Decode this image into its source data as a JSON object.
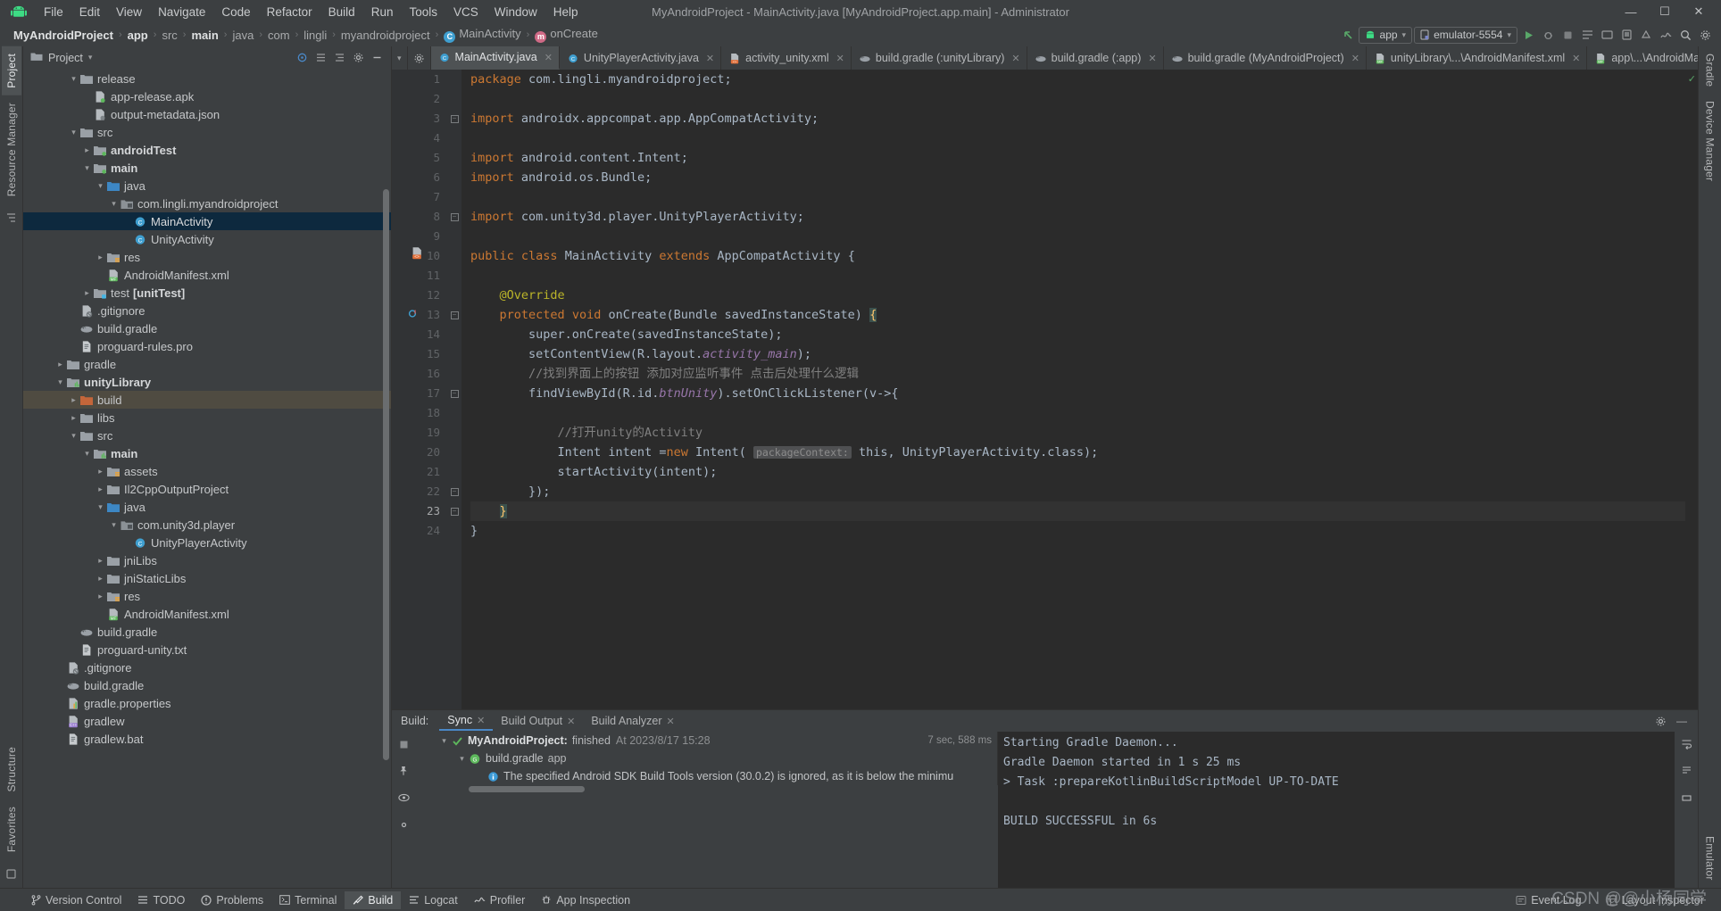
{
  "window": {
    "title": "MyAndroidProject - MainActivity.java [MyAndroidProject.app.main] - Administrator",
    "minimize": "—",
    "maximize": "☐",
    "close": "✕",
    "app_icon": "android-robot-icon"
  },
  "menu": {
    "items": [
      {
        "label": "File"
      },
      {
        "label": "Edit"
      },
      {
        "label": "View"
      },
      {
        "label": "Navigate"
      },
      {
        "label": "Code"
      },
      {
        "label": "Refactor"
      },
      {
        "label": "Build"
      },
      {
        "label": "Run"
      },
      {
        "label": "Tools"
      },
      {
        "label": "VCS"
      },
      {
        "label": "Window"
      },
      {
        "label": "Help"
      }
    ]
  },
  "breadcrumbs": {
    "sep": "›",
    "items": [
      {
        "label": "MyAndroidProject",
        "bold": true,
        "icon": ""
      },
      {
        "label": "app",
        "bold": true,
        "icon": ""
      },
      {
        "label": "src",
        "bold": false,
        "icon": ""
      },
      {
        "label": "main",
        "bold": true,
        "icon": ""
      },
      {
        "label": "java",
        "bold": false,
        "icon": ""
      },
      {
        "label": "com",
        "bold": false,
        "icon": ""
      },
      {
        "label": "lingli",
        "bold": false,
        "icon": ""
      },
      {
        "label": "myandroidproject",
        "bold": false,
        "icon": ""
      },
      {
        "label": "MainActivity",
        "bold": false,
        "icon": "c"
      },
      {
        "label": "onCreate",
        "bold": false,
        "icon": "m"
      }
    ]
  },
  "toolbar": {
    "back_arrow": "back-arrow-icon",
    "module_selector": "app",
    "device_selector": "emulator-5554",
    "dropdown_caret": "▾",
    "run_button": "▶",
    "debug_button": "debug-icon",
    "icons": [
      "run",
      "debug",
      "stop",
      "layout-inspector",
      "device-file-explorer",
      "avd-manager",
      "sdk-manager",
      "profiler",
      "search",
      "settings"
    ]
  },
  "left_strip": {
    "tabs": [
      {
        "label": "Project",
        "active": true
      },
      {
        "label": "Resource Manager",
        "active": false
      }
    ],
    "bottom_tabs": [
      {
        "label": "Structure"
      },
      {
        "label": "Favorites"
      }
    ]
  },
  "right_strip": {
    "tabs": [
      {
        "label": "Gradle"
      },
      {
        "label": "Device Manager"
      },
      {
        "label": "Emulator"
      }
    ]
  },
  "project_panel": {
    "title": "Project",
    "header_icons": [
      "target-icon",
      "collapse-all-icon",
      "expand-icon",
      "settings-icon",
      "hide-icon"
    ],
    "tree": [
      {
        "indent": 3,
        "arrow": "v",
        "icon": "folder",
        "label": "release",
        "bold": false
      },
      {
        "indent": 4,
        "arrow": "",
        "icon": "apk",
        "label": "app-release.apk",
        "bold": false
      },
      {
        "indent": 4,
        "arrow": "",
        "icon": "json",
        "label": "output-metadata.json",
        "bold": false
      },
      {
        "indent": 3,
        "arrow": "v",
        "icon": "folder",
        "label": "src",
        "bold": false
      },
      {
        "indent": 4,
        "arrow": ">",
        "icon": "folder-green",
        "label": "androidTest",
        "bold": true
      },
      {
        "indent": 4,
        "arrow": "v",
        "icon": "folder-green",
        "label": "main",
        "bold": true
      },
      {
        "indent": 5,
        "arrow": "v",
        "icon": "folder-blue",
        "label": "java",
        "bold": false
      },
      {
        "indent": 6,
        "arrow": "v",
        "icon": "package",
        "label": "com.lingli.myandroidproject",
        "bold": false
      },
      {
        "indent": 7,
        "arrow": "",
        "icon": "class",
        "label": "MainActivity",
        "bold": false,
        "state": "sel"
      },
      {
        "indent": 7,
        "arrow": "",
        "icon": "class",
        "label": "UnityActivity",
        "bold": false
      },
      {
        "indent": 5,
        "arrow": ">",
        "icon": "folder-res",
        "label": "res",
        "bold": false
      },
      {
        "indent": 5,
        "arrow": "",
        "icon": "manifest",
        "label": "AndroidManifest.xml",
        "bold": false
      },
      {
        "indent": 4,
        "arrow": ">",
        "icon": "folder-test",
        "label": "test",
        "bold": false,
        "suffix": "[unitTest]"
      },
      {
        "indent": 3,
        "arrow": "",
        "icon": "gitignore",
        "label": ".gitignore",
        "bold": false
      },
      {
        "indent": 3,
        "arrow": "",
        "icon": "gradle",
        "label": "build.gradle",
        "bold": false
      },
      {
        "indent": 3,
        "arrow": "",
        "icon": "textfile",
        "label": "proguard-rules.pro",
        "bold": false
      },
      {
        "indent": 2,
        "arrow": ">",
        "icon": "folder",
        "label": "gradle",
        "bold": false
      },
      {
        "indent": 2,
        "arrow": "v",
        "icon": "module",
        "label": "unityLibrary",
        "bold": true
      },
      {
        "indent": 3,
        "arrow": ">",
        "icon": "folder-build",
        "label": "build",
        "bold": false,
        "state": "build-sel"
      },
      {
        "indent": 3,
        "arrow": ">",
        "icon": "folder",
        "label": "libs",
        "bold": false
      },
      {
        "indent": 3,
        "arrow": "v",
        "icon": "folder",
        "label": "src",
        "bold": false
      },
      {
        "indent": 4,
        "arrow": "v",
        "icon": "module",
        "label": "main",
        "bold": true
      },
      {
        "indent": 5,
        "arrow": ">",
        "icon": "folder-res",
        "label": "assets",
        "bold": false
      },
      {
        "indent": 5,
        "arrow": ">",
        "icon": "folder",
        "label": "Il2CppOutputProject",
        "bold": false
      },
      {
        "indent": 5,
        "arrow": "v",
        "icon": "folder-blue",
        "label": "java",
        "bold": false
      },
      {
        "indent": 6,
        "arrow": "v",
        "icon": "package",
        "label": "com.unity3d.player",
        "bold": false
      },
      {
        "indent": 7,
        "arrow": "",
        "icon": "class",
        "label": "UnityPlayerActivity",
        "bold": false
      },
      {
        "indent": 5,
        "arrow": ">",
        "icon": "folder",
        "label": "jniLibs",
        "bold": false
      },
      {
        "indent": 5,
        "arrow": ">",
        "icon": "folder",
        "label": "jniStaticLibs",
        "bold": false
      },
      {
        "indent": 5,
        "arrow": ">",
        "icon": "folder-res",
        "label": "res",
        "bold": false
      },
      {
        "indent": 5,
        "arrow": "",
        "icon": "manifest",
        "label": "AndroidManifest.xml",
        "bold": false
      },
      {
        "indent": 3,
        "arrow": "",
        "icon": "gradle",
        "label": "build.gradle",
        "bold": false
      },
      {
        "indent": 3,
        "arrow": "",
        "icon": "textfile",
        "label": "proguard-unity.txt",
        "bold": false
      },
      {
        "indent": 2,
        "arrow": "",
        "icon": "gitignore",
        "label": ".gitignore",
        "bold": false
      },
      {
        "indent": 2,
        "arrow": "",
        "icon": "gradle",
        "label": "build.gradle",
        "bold": false
      },
      {
        "indent": 2,
        "arrow": "",
        "icon": "properties",
        "label": "gradle.properties",
        "bold": false
      },
      {
        "indent": 2,
        "arrow": "",
        "icon": "gradlew",
        "label": "gradlew",
        "bold": false
      },
      {
        "indent": 2,
        "arrow": "",
        "icon": "textfile",
        "label": "gradlew.bat",
        "bold": false
      }
    ]
  },
  "editor": {
    "tabs": [
      {
        "label": "MainActivity.java",
        "icon": "class",
        "active": true
      },
      {
        "label": "UnityPlayerActivity.java",
        "icon": "class",
        "active": false
      },
      {
        "label": "activity_unity.xml",
        "icon": "layout",
        "active": false
      },
      {
        "label": "build.gradle (:unityLibrary)",
        "icon": "gradle",
        "active": false
      },
      {
        "label": "build.gradle (:app)",
        "icon": "gradle",
        "active": false
      },
      {
        "label": "build.gradle (MyAndroidProject)",
        "icon": "gradle",
        "active": false
      },
      {
        "label": "unityLibrary\\...\\AndroidManifest.xml",
        "icon": "manifest",
        "active": false
      },
      {
        "label": "app\\...\\AndroidMa",
        "icon": "manifest",
        "active": false
      }
    ],
    "overflow_caret": "⌄",
    "filename": "MainActivity.java",
    "lines": [
      {
        "no": 1,
        "text": "package com.lingli.myandroidproject;"
      },
      {
        "no": 2,
        "text": ""
      },
      {
        "no": 3,
        "text": "import androidx.appcompat.app.AppCompatActivity;"
      },
      {
        "no": 4,
        "text": ""
      },
      {
        "no": 5,
        "text": "import android.content.Intent;"
      },
      {
        "no": 6,
        "text": "import android.os.Bundle;"
      },
      {
        "no": 7,
        "text": ""
      },
      {
        "no": 8,
        "text": "import com.unity3d.player.UnityPlayerActivity;"
      },
      {
        "no": 9,
        "text": ""
      },
      {
        "no": 10,
        "text": "public class MainActivity extends AppCompatActivity {"
      },
      {
        "no": 11,
        "text": ""
      },
      {
        "no": 12,
        "text": "    @Override"
      },
      {
        "no": 13,
        "text": "    protected void onCreate(Bundle savedInstanceState) {"
      },
      {
        "no": 14,
        "text": "        super.onCreate(savedInstanceState);"
      },
      {
        "no": 15,
        "text": "        setContentView(R.layout.activity_main);"
      },
      {
        "no": 16,
        "text": "        //找到界面上的按钮 添加对应监听事件 点击后处理什么逻辑"
      },
      {
        "no": 17,
        "text": "        findViewById(R.id.btnUnity).setOnClickListener(v->{"
      },
      {
        "no": 18,
        "text": ""
      },
      {
        "no": 19,
        "text": "            //打开unity的Activity"
      },
      {
        "no": 20,
        "text": "            Intent intent =new Intent( packageContext: this, UnityPlayerActivity.class);"
      },
      {
        "no": 21,
        "text": "            startActivity(intent);"
      },
      {
        "no": 22,
        "text": "        });"
      },
      {
        "no": 23,
        "text": "    }"
      },
      {
        "no": 24,
        "text": "}"
      }
    ],
    "param_hint": "packageContext:",
    "current_line": 23,
    "inspection_status": "✓"
  },
  "build_panel": {
    "title": "Build:",
    "tabs": [
      {
        "label": "Sync",
        "active": true
      },
      {
        "label": "Build Output",
        "active": false
      },
      {
        "label": "Build Analyzer",
        "active": false
      }
    ],
    "settings_icon": "gear-icon",
    "minimize_icon": "—",
    "tree": [
      {
        "indent": 1,
        "arrow": "v",
        "icon": "check",
        "label": "MyAndroidProject:",
        "bold": true,
        "suffix": "finished",
        "meta": "At 2023/8/17 15:28",
        "duration": "7 sec, 588 ms"
      },
      {
        "indent": 2,
        "arrow": "v",
        "icon": "gradle-green",
        "label": "build.gradle",
        "bold": false,
        "suffix": "app"
      },
      {
        "indent": 3,
        "arrow": "",
        "icon": "info",
        "label": "The specified Android SDK Build Tools version (30.0.2) is ignored, as it is below the minimu",
        "bold": false
      }
    ],
    "console": [
      "Starting Gradle Daemon...",
      "Gradle Daemon started in 1 s 25 ms",
      "> Task :prepareKotlinBuildScriptModel UP-TO-DATE",
      "",
      "BUILD SUCCESSFUL in 6s"
    ]
  },
  "statusbar": {
    "items": [
      {
        "label": "Version Control",
        "icon": "branch-icon",
        "active": false
      },
      {
        "label": "TODO",
        "icon": "list-icon",
        "active": false
      },
      {
        "label": "Problems",
        "icon": "problems-icon",
        "active": false
      },
      {
        "label": "Terminal",
        "icon": "terminal-icon",
        "active": false
      },
      {
        "label": "Build",
        "icon": "build-hammer-icon",
        "active": true
      },
      {
        "label": "Logcat",
        "icon": "logcat-icon",
        "active": false
      },
      {
        "label": "Profiler",
        "icon": "profiler-icon",
        "active": false
      },
      {
        "label": "App Inspection",
        "icon": "app-inspection-icon",
        "active": false
      }
    ],
    "right": [
      {
        "label": "Event Log",
        "icon": "event-log-icon"
      },
      {
        "label": "Layout Inspector",
        "icon": "layout-inspector-icon"
      }
    ],
    "watermark": "CSDN @@小杨同学"
  },
  "colors": {
    "bg": "#3c3f41",
    "editor_bg": "#2b2b2b",
    "accent_blue": "#4a88c7",
    "selection": "#0d293e",
    "keyword_orange": "#cc7832",
    "string_green": "#6a8759",
    "comment_gray": "#808080",
    "field_purple": "#9876aa",
    "annotation_yellow": "#bbb529",
    "green_run": "#59a869",
    "build_folder": "#c4663a"
  }
}
